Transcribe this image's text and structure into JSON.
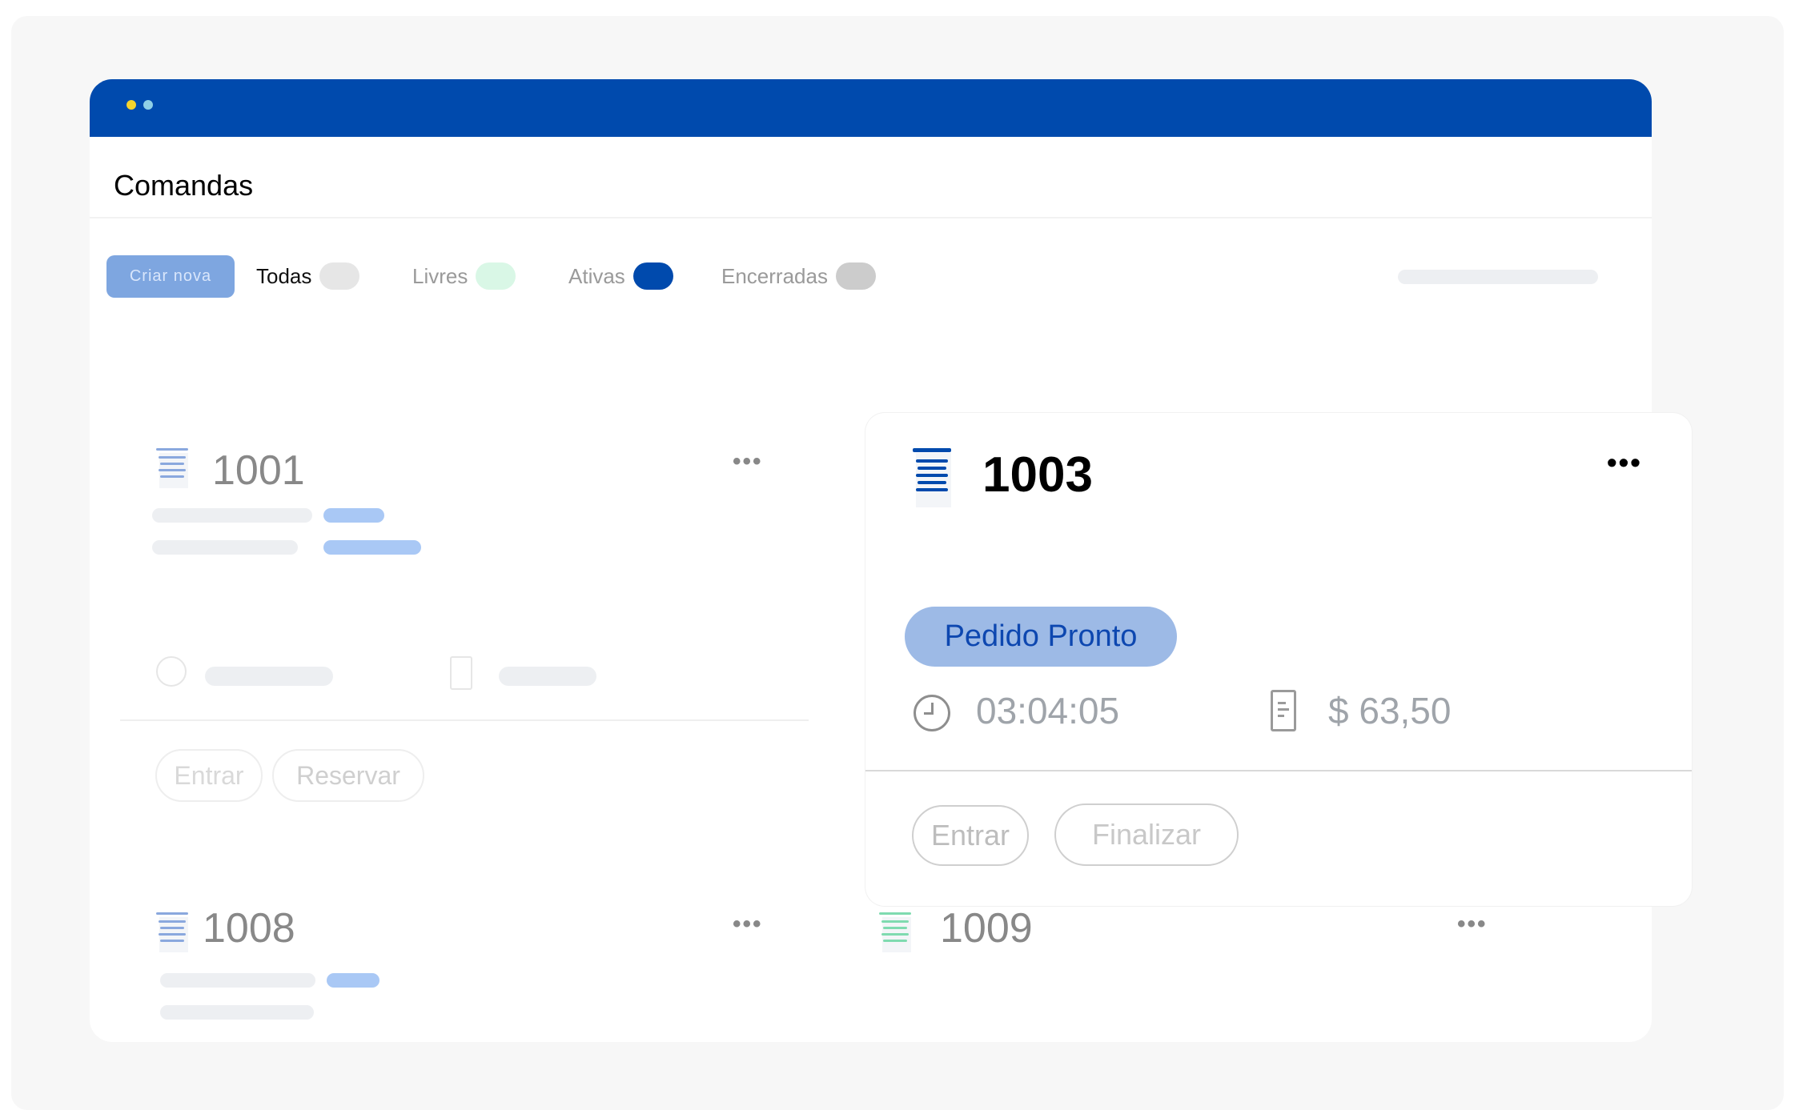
{
  "page": {
    "title": "Comandas"
  },
  "toolbar": {
    "create_label": "Criar nova",
    "filters": [
      {
        "label": "Todas",
        "color": "#e6e6e6"
      },
      {
        "label": "Livres",
        "color": "#d9f7e6"
      },
      {
        "label": "Ativas",
        "color": "#004aad"
      },
      {
        "label": "Encerradas",
        "color": "#cccccc"
      }
    ]
  },
  "cards": {
    "c1001": {
      "number": "1001",
      "more": "•••",
      "enter_label": "Entrar",
      "reserve_label": "Reservar"
    },
    "c1003": {
      "number": "1003",
      "more": "•••",
      "status": "Pedido Pronto",
      "time": "03:04:05",
      "amount": "$ 63,50",
      "enter_label": "Entrar",
      "finish_label": "Finalizar"
    },
    "c1008": {
      "number": "1008",
      "more": "•••"
    },
    "c1009": {
      "number": "1009",
      "more": "•••"
    }
  },
  "colors": {
    "brand": "#004aad",
    "badge_bg": "#9dbae6",
    "free": "#5fcf9a",
    "skeleton": "#edeff2",
    "skeleton_blue": "#a9c8f5"
  },
  "icons": [
    "comanda-icon",
    "more-icon",
    "clock-icon",
    "receipt-icon"
  ]
}
